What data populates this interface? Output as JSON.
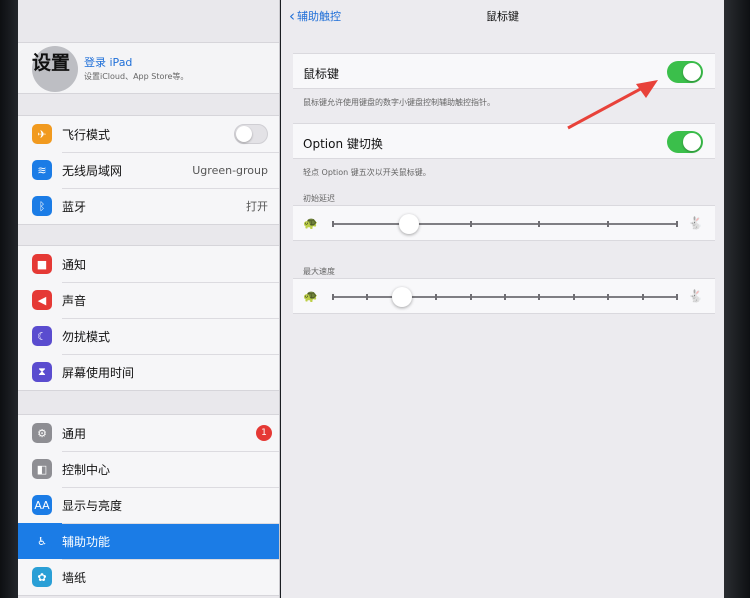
{
  "sidebar": {
    "title": "设置",
    "account": {
      "login": "登录 iPad",
      "subtitle": "设置iCloud、App Store等。"
    },
    "group1": [
      {
        "label": "飞行模式",
        "icon": "airplane-icon",
        "color": "#f19a1f",
        "glyph": "✈"
      },
      {
        "label": "无线局域网",
        "value": "Ugreen-group",
        "icon": "wifi-icon",
        "color": "#1b7ce6",
        "glyph": "≋"
      },
      {
        "label": "蓝牙",
        "value": "打开",
        "icon": "bluetooth-icon",
        "color": "#1b7ce6",
        "glyph": "ᛒ"
      }
    ],
    "group2": [
      {
        "label": "通知",
        "icon": "notification-icon",
        "color": "#e53935",
        "glyph": "■"
      },
      {
        "label": "声音",
        "icon": "speaker-icon",
        "color": "#e53935",
        "glyph": "◀"
      },
      {
        "label": "勿扰模式",
        "icon": "moon-icon",
        "color": "#5a4ccf",
        "glyph": "☾"
      },
      {
        "label": "屏幕使用时间",
        "icon": "hourglass-icon",
        "color": "#5a4ccf",
        "glyph": "⧗"
      }
    ],
    "group3": [
      {
        "label": "通用",
        "badge": "1",
        "icon": "gear-icon",
        "color": "#8e8e93",
        "glyph": "⚙"
      },
      {
        "label": "控制中心",
        "icon": "control-center-icon",
        "color": "#8e8e93",
        "glyph": "◧"
      },
      {
        "label": "显示与亮度",
        "icon": "display-icon",
        "color": "#1b7ce6",
        "glyph": "AA"
      },
      {
        "label": "辅助功能",
        "icon": "accessibility-icon",
        "color": "#1b7ce6",
        "glyph": "♿",
        "active": true
      },
      {
        "label": "墙纸",
        "icon": "wallpaper-icon",
        "color": "#2a9fd6",
        "glyph": "✿"
      }
    ]
  },
  "main": {
    "back_label": "辅助触控",
    "title": "鼠标键",
    "mouse_keys": {
      "label": "鼠标键",
      "on": true,
      "footnote": "鼠标键允许使用键盘的数字小键盘控制辅助触控指针。"
    },
    "option_toggle": {
      "label": "Option 键切换",
      "on": true,
      "footnote": "轻点 Option 键五次以开关鼠标键。"
    },
    "initial_delay": {
      "header": "初始延迟",
      "value": 0.22,
      "ticks": 5,
      "slow_icon": "turtle-icon",
      "fast_icon": "hare-icon"
    },
    "max_speed": {
      "header": "最大速度",
      "value": 0.2,
      "ticks": 10,
      "slow_icon": "turtle-icon",
      "fast_icon": "hare-icon"
    }
  },
  "colors": {
    "accent": "#1b7ce6",
    "toggle_on": "#3bbf4b",
    "arrow": "#e8423a"
  }
}
